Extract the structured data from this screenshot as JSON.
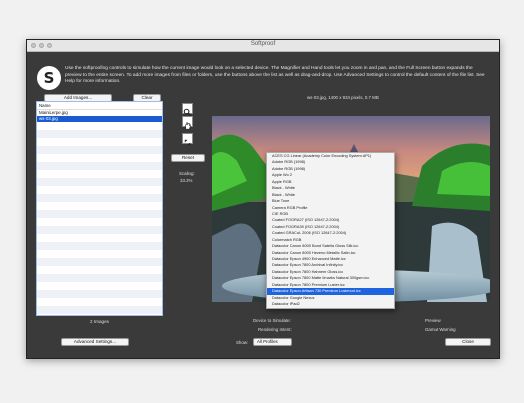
{
  "window": {
    "title": "Softproof"
  },
  "instructions": "Use the softproofing controls to simulate how the current image would look on a selected device. The Magnifier and Hand tools let you zoom in and pan, and the Full Screen button expands the preview to the entire screen. To add more images from files or folders, use the buttons above the list as well as drag-and-drop. Use Advanced Settings to control the default content of the file list. See Help for more information.",
  "logo_letter": "S",
  "sidebar": {
    "add_images_label": "Add Images...",
    "clear_label": "Clear",
    "list_header": "Name",
    "files": [
      "MainiLerpe.jpg",
      "ws-03.jpg"
    ],
    "selected_index": 1,
    "count_text": "2 Images",
    "advanced_label": "Advanced Settings..."
  },
  "tools": {
    "reset_label": "Reset",
    "scaling_label": "Scaling:",
    "scaling_value": "33.2%"
  },
  "image_info": "ws-03.jpg, 1400 x 934 pixels, 0.7 MB",
  "profile_menu": {
    "items": [
      "ACES CG Linear (Academy Color Encoding System AP1)",
      "Adobe RGB (1998)",
      "Adobe RGB (1998)",
      "Apple Wo 2",
      "Apple RGB",
      "Black - White",
      "Black - White",
      "Blue Tone",
      "Camera RGB Profile",
      "CIE RGB",
      "Coated FOGRA27 (ISO 12647-2:2004)",
      "Coated FOGRA39 (ISO 12647-2:2004)",
      "Coated GRACoL 2006 (ISO 12647-2:2004)",
      "Colormatch RGB",
      "Datacolor Canon 8000 Bond Satella Gloss Silk.icc",
      "Datacolor Canon 8000 Hezeno Metallic Satin.icc",
      "Datacolor Epson 4900 Enhanced Matte.icc",
      "Datacolor Epson 7800 Archival Infinity.icc",
      "Datacolor Epson 7800 Hahnem Gloss.icc",
      "Datacolor Epson 7800 Matte Ilmarks Natural 300gsm.icc",
      "Datacolor Epson 7800 Premium Luster.icc",
      "Datacolor Epson Artisan 730 Premium Lustercol.icc",
      "Datacolor Google Nexus",
      "Datacolor iPad2",
      "Datacolor Lenovo",
      "Display P3"
    ],
    "selected_index": 21
  },
  "bottom": {
    "device_label": "Device to Simulate:",
    "preview_label": "Preview",
    "intent_label": "Rendering Intent:",
    "gamut_label": "Gamut Warning",
    "show_label": "Show:",
    "show_value": "All Profiles",
    "close_label": "Close"
  }
}
